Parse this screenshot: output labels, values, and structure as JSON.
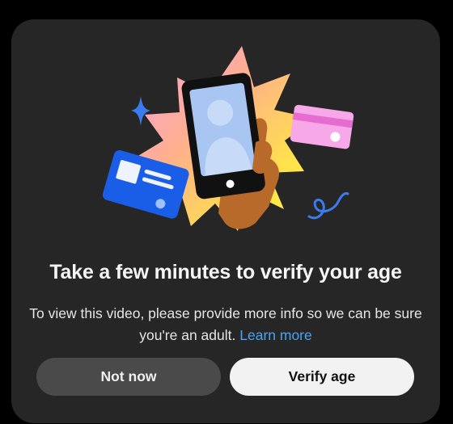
{
  "dialog": {
    "title": "Take a few minutes to verify your age",
    "description": "To view this video, please provide more info so we can be sure you're an adult.",
    "learn_more_label": "Learn more",
    "secondary_button_label": "Not now",
    "primary_button_label": "Verify age"
  },
  "illustration": {
    "name": "age-verification-illustration",
    "elements": [
      "starburst",
      "phone-with-person",
      "hand",
      "blue-id-card",
      "pink-credit-card",
      "sparkle",
      "squiggle"
    ]
  },
  "colors": {
    "modal_background": "#262626",
    "page_background": "#000000",
    "link": "#4aa3f0",
    "secondary_button": "#4a4a4a",
    "primary_button": "#f2f2f2",
    "id_card": "#1a5ee8",
    "credit_card": "#f7a8e8",
    "sparkle": "#3b7bf0",
    "phone_screen": "#a9c6f3",
    "hand": "#b86a2a"
  }
}
